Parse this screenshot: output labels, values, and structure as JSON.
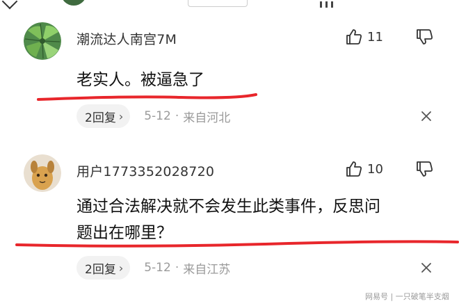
{
  "comments": [
    {
      "username": "潮流达人南宫7M",
      "likes": "11",
      "text_lines": [
        "老实人。被逼急了"
      ],
      "replies": "2回复",
      "date": "5-12",
      "location": "来自河北",
      "avatar_icon": "green-plant-avatar-icon"
    },
    {
      "username": "用户1773352028720",
      "likes": "10",
      "text_lines": [
        "通过合法解决就不会发生此类事件，反思问",
        "题出在哪里？"
      ],
      "replies": "2回复",
      "date": "5-12",
      "location": "来自江苏",
      "avatar_icon": "cartoon-dog-avatar-icon"
    }
  ],
  "meta_separator": "·",
  "reply_chevron": "›",
  "watermark": "网易号 | 一只破笔半支烟",
  "colors": {
    "underline": "#e8262b",
    "meta": "#9a9a9a",
    "pill_bg": "#f2f2f2"
  }
}
